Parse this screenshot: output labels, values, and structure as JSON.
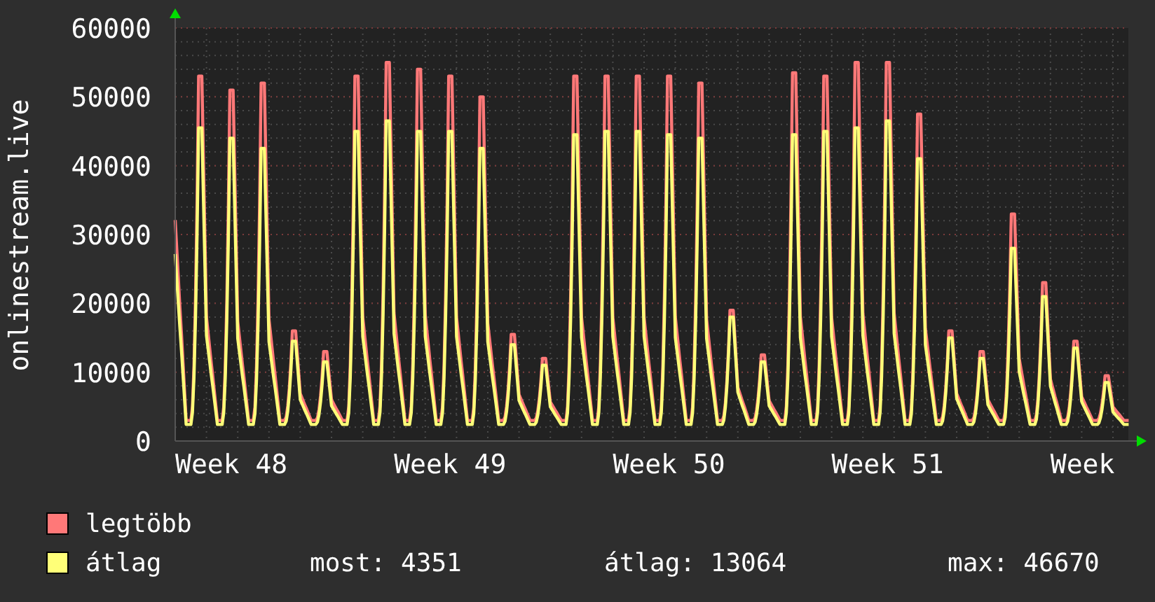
{
  "graph": {
    "y_axis_title": "onlinestream.live",
    "y_ticks": [
      "60000",
      "50000",
      "40000",
      "30000",
      "20000",
      "10000",
      "0"
    ],
    "x_ticks": [
      "Week 48",
      "Week 49",
      "Week 50",
      "Week 51",
      "Week"
    ],
    "legend": [
      {
        "name": "legtöbb",
        "color": "#ff7878"
      },
      {
        "name": "átlag",
        "color": "#ffff78"
      }
    ],
    "stats": [
      "most: 4351",
      "átlag: 13064",
      "max: 46670"
    ]
  }
}
